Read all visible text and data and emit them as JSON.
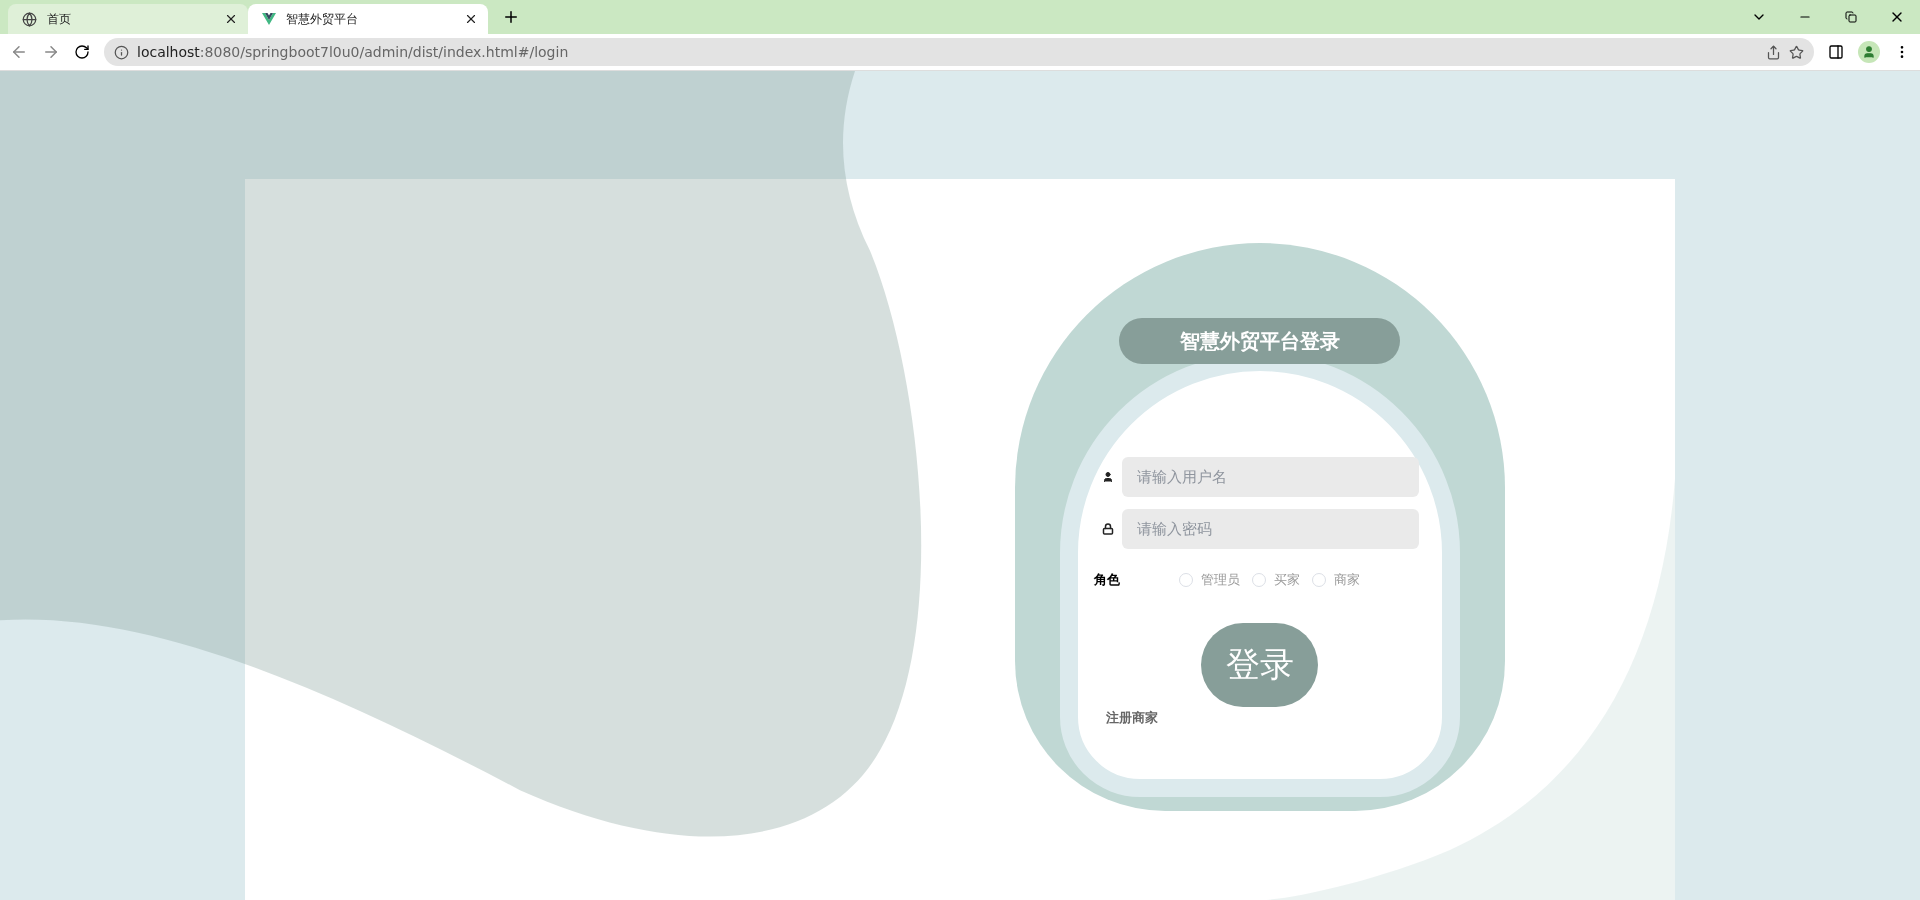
{
  "browser": {
    "tabs": [
      {
        "kind": "web",
        "title": "首页",
        "selected": false
      },
      {
        "kind": "app",
        "title": "智慧外贸平台",
        "selected": true
      }
    ],
    "address": {
      "host": "localhost",
      "path": ":8080/springboot7l0u0/admin/dist/index.html#/login"
    }
  },
  "login": {
    "title": "智慧外贸平台登录",
    "username": {
      "placeholder": "请输入用户名"
    },
    "password": {
      "placeholder": "请输入密码"
    },
    "role_label": "角色",
    "roles": [
      {
        "label": "管理员",
        "selected": false
      },
      {
        "label": "买家",
        "selected": false
      },
      {
        "label": "商家",
        "selected": false
      }
    ],
    "submit": "登录",
    "register_link": "注册商家"
  }
}
